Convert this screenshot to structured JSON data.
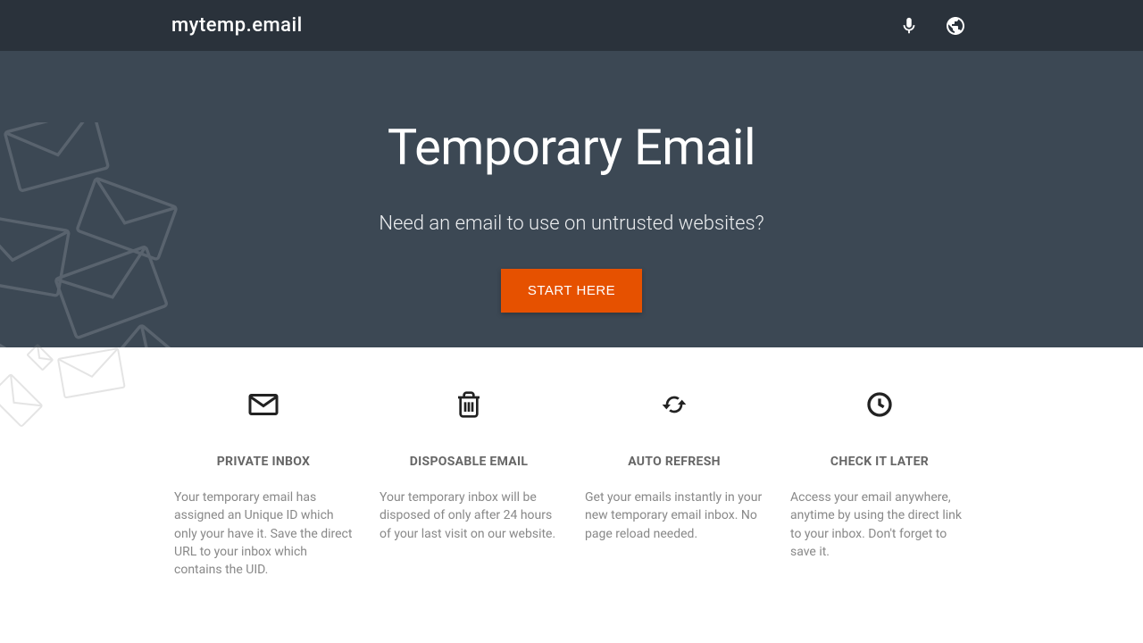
{
  "header": {
    "logo": "mytemp.email"
  },
  "hero": {
    "title": "Temporary Email",
    "subtitle": "Need an email to use on untrusted websites?",
    "cta": "START HERE"
  },
  "features": [
    {
      "icon": "envelope",
      "title": "PRIVATE INBOX",
      "desc": "Your temporary email has assigned an Unique ID which only your have it. Save the direct URL to your inbox which contains the UID."
    },
    {
      "icon": "trash",
      "title": "DISPOSABLE EMAIL",
      "desc": "Your temporary inbox will be disposed of only after 24 hours of your last visit on our website."
    },
    {
      "icon": "refresh",
      "title": "AUTO REFRESH",
      "desc": "Get your emails instantly in your new temporary email inbox. No page reload needed."
    },
    {
      "icon": "clock",
      "title": "CHECK IT LATER",
      "desc": "Access your email anywhere, anytime by using the direct link to your inbox. Don't forget to save it."
    }
  ]
}
